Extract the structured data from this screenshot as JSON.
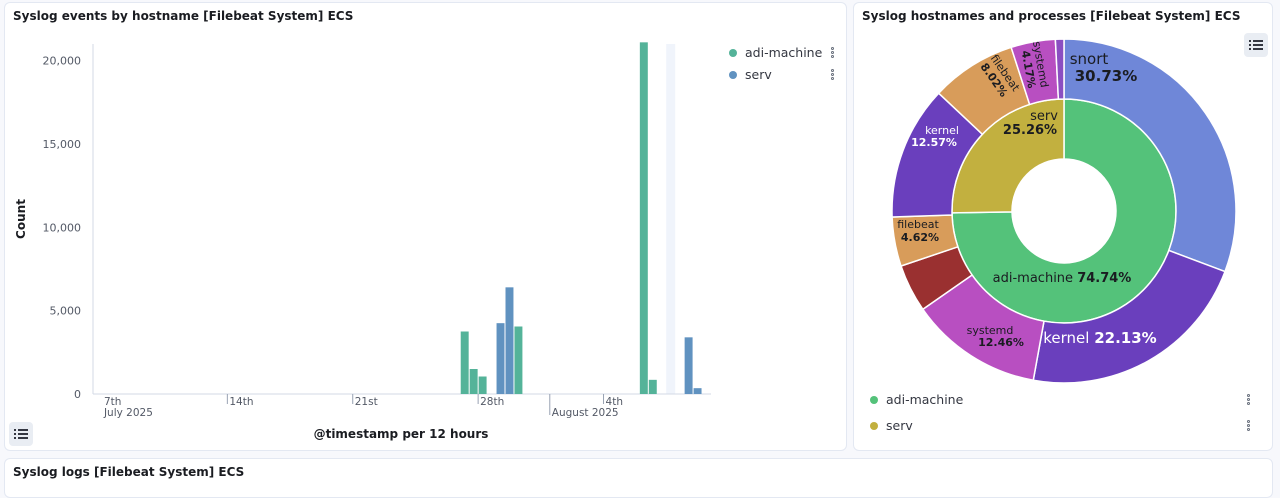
{
  "panel1": {
    "title": "Syslog events by hostname [Filebeat System] ECS",
    "legend": [
      {
        "label": "adi-machine",
        "color": "#54b399"
      },
      {
        "label": "serv",
        "color": "#6092c0"
      }
    ]
  },
  "panel2": {
    "title": "Syslog hostnames and processes [Filebeat System] ECS",
    "legend": [
      {
        "label": "adi-machine",
        "color": "#54c27a"
      },
      {
        "label": "serv",
        "color": "#c2b03f"
      }
    ]
  },
  "panel3": {
    "title": "Syslog logs [Filebeat System] ECS"
  },
  "chart_data": [
    {
      "type": "bar",
      "title": "Syslog events by hostname [Filebeat System] ECS",
      "xlabel": "@timestamp per 12 hours",
      "ylabel": "Count",
      "ylim": [
        0,
        21000
      ],
      "yticks": [
        "0",
        "5,000",
        "10,000",
        "15,000",
        "20,000"
      ],
      "xticks": [
        {
          "label": "7th",
          "sub": "July 2025"
        },
        {
          "label": "14th",
          "sub": ""
        },
        {
          "label": "21st",
          "sub": ""
        },
        {
          "label": "28th",
          "sub": ""
        },
        {
          "label": "",
          "sub": "August 2025"
        },
        {
          "label": "4th",
          "sub": ""
        }
      ],
      "series": [
        {
          "name": "adi-machine",
          "color": "#54b399",
          "points": [
            {
              "x": "2025-07-27 00:00",
              "y": 3750
            },
            {
              "x": "2025-07-27 12:00",
              "y": 1500
            },
            {
              "x": "2025-07-28 00:00",
              "y": 1050
            },
            {
              "x": "2025-07-29 12:00",
              "y": 3900
            },
            {
              "x": "2025-07-30 00:00",
              "y": 4050
            },
            {
              "x": "2025-08-06 00:00",
              "y": 21100
            },
            {
              "x": "2025-08-06 12:00",
              "y": 850
            }
          ]
        },
        {
          "name": "serv",
          "color": "#6092c0",
          "points": [
            {
              "x": "2025-07-29 00:00",
              "y": 4250
            },
            {
              "x": "2025-07-29 12:00",
              "y": 6400
            },
            {
              "x": "2025-08-08 12:00",
              "y": 3400
            },
            {
              "x": "2025-08-09 00:00",
              "y": 350
            }
          ]
        }
      ]
    },
    {
      "type": "pie",
      "title": "Syslog hostnames and processes [Filebeat System] ECS",
      "inner": [
        {
          "label": "adi-machine",
          "value": 74.74,
          "display": "74.74%",
          "color": "#54c27a"
        },
        {
          "label": "serv",
          "value": 25.26,
          "display": "25.26%",
          "color": "#c2b03f"
        }
      ],
      "outer": [
        {
          "label": "snort",
          "value": 30.73,
          "display": "30.73%",
          "color": "#6f87d8"
        },
        {
          "label": "kernel",
          "value": 22.13,
          "display": "22.13%",
          "color": "#6a3fbd"
        },
        {
          "label": "systemd",
          "value": 12.46,
          "display": "12.46%",
          "color": "#b84fc1"
        },
        {
          "label": "",
          "value": 4.5,
          "display": "",
          "color": "#9a3030"
        },
        {
          "label": "filebeat",
          "value": 4.62,
          "display": "4.62%",
          "color": "#d89c5a"
        },
        {
          "label": "kernel",
          "value": 12.57,
          "display": "12.57%",
          "color": "#6a3fbd"
        },
        {
          "label": "filebeat",
          "value": 8.02,
          "display": "8.02%",
          "color": "#d89c5a"
        },
        {
          "label": "systemd",
          "value": 4.17,
          "display": "4.17%",
          "color": "#b84fc1"
        },
        {
          "label": "",
          "value": 0.8,
          "display": "",
          "color": "#8b4fc1"
        }
      ]
    }
  ]
}
